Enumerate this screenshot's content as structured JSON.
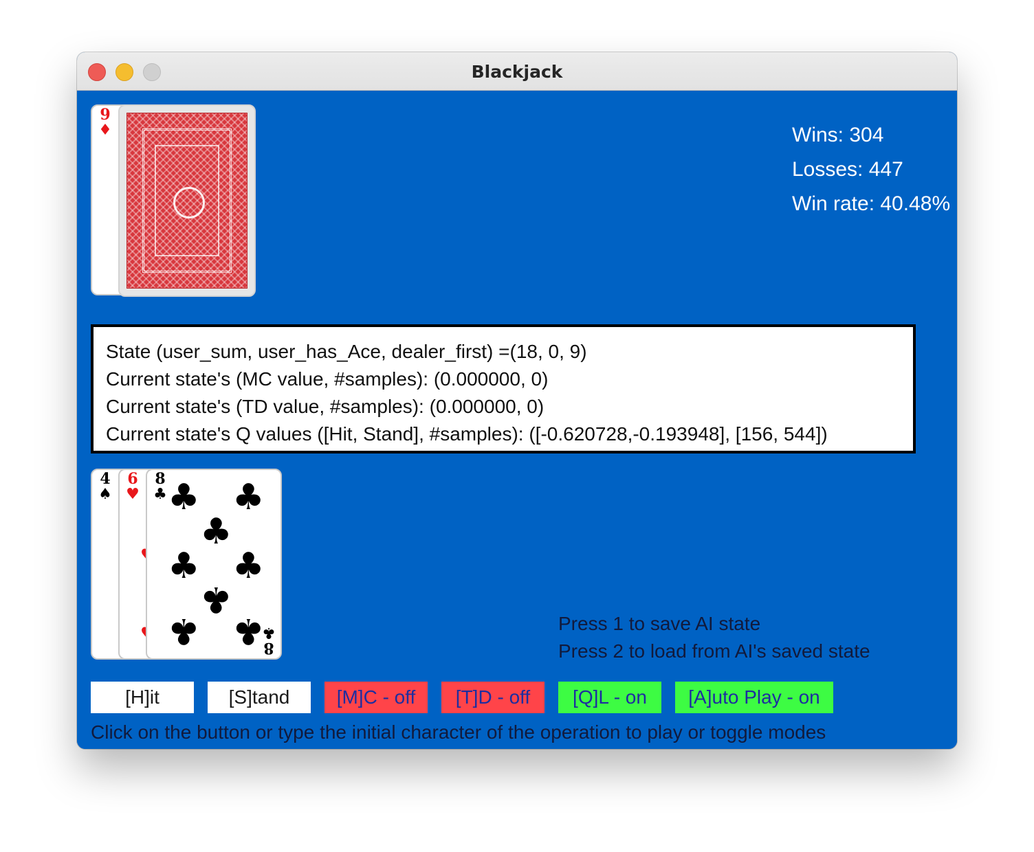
{
  "window": {
    "title": "Blackjack"
  },
  "dealer": {
    "cards": [
      {
        "rank": "9",
        "suit": "♦",
        "color": "red"
      },
      {
        "face": "back",
        "back_color": "#d8373d"
      }
    ]
  },
  "player": {
    "cards": [
      {
        "rank": "4",
        "suit": "♠",
        "color": "black"
      },
      {
        "rank": "6",
        "suit": "♥",
        "color": "red"
      },
      {
        "rank": "8",
        "suit": "♣",
        "color": "black"
      }
    ]
  },
  "stats": {
    "wins": "Wins: 304",
    "losses": "Losses: 447",
    "win_rate": "Win rate: 40.48%"
  },
  "state_panel": {
    "line1": "State (user_sum, user_has_Ace, dealer_first) =(18, 0, 9)",
    "line2": "Current state's (MC value, #samples): (0.000000, 0)",
    "line3": "Current state's (TD value, #samples): (0.000000, 0)",
    "line4": "Current state's Q values ([Hit, Stand], #samples): ([-0.620728,-0.193948], [156, 544])"
  },
  "instructions": {
    "save": "Press 1 to save AI state",
    "load": "Press 2 to load from AI's saved state"
  },
  "buttons": {
    "hit": "[H]it",
    "stand": "[S]tand",
    "mc": "[M]C - off",
    "td": "[T]D - off",
    "ql": "[Q]L - on",
    "auto": "[A]uto Play - on"
  },
  "footer": "Click on the button or type the initial character of the operation to play or toggle modes",
  "colors": {
    "table": "#0062c4",
    "button_off": "#ff4449",
    "button_on": "#3dfc43",
    "button_neutral": "#ffffff"
  }
}
